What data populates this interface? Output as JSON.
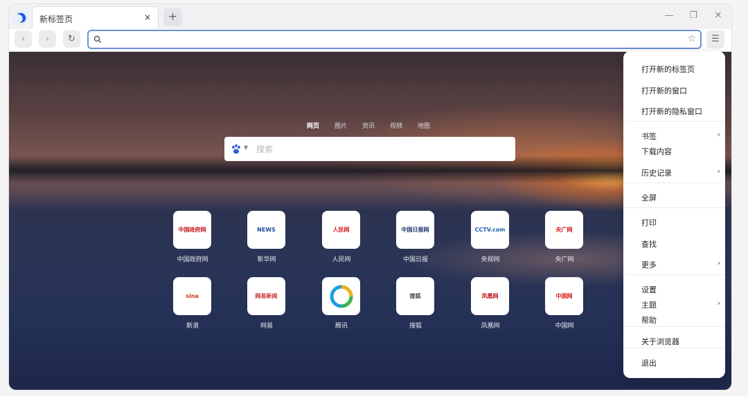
{
  "tab": {
    "title": "新标签页",
    "close_glyph": "×",
    "new_glyph": "+"
  },
  "window_controls": {
    "minimize": "—",
    "maximize": "❐",
    "close": "✕"
  },
  "toolbar": {
    "back_glyph": "‹",
    "forward_glyph": "›",
    "reload_glyph": "↻",
    "url_value": "",
    "url_placeholder": "",
    "bookmark_glyph": "☆",
    "menu_glyph": "☰"
  },
  "search": {
    "tabs": [
      "网页",
      "图片",
      "资讯",
      "视频",
      "地图"
    ],
    "active_tab": "网页",
    "placeholder": "搜索",
    "engine_icon": "baidu-paw-icon"
  },
  "tiles": [
    {
      "label": "中国政府网",
      "logo_text": "中国政府网",
      "logo_color": "#c8171e"
    },
    {
      "label": "新华网",
      "logo_text": "NEWS",
      "logo_color": "#1d4f9c"
    },
    {
      "label": "人民网",
      "logo_text": "人民网",
      "logo_color": "#d4161d"
    },
    {
      "label": "中国日报",
      "logo_text": "中国日报网",
      "logo_color": "#1f3a6e"
    },
    {
      "label": "央视网",
      "logo_text": "CCTV.com",
      "logo_color": "#1e5fb4"
    },
    {
      "label": "央广网",
      "logo_text": "央广网",
      "logo_color": "#d11c1c"
    },
    {
      "label": "新浪",
      "logo_text": "sina",
      "logo_color": "#d52b1e"
    },
    {
      "label": "网易",
      "logo_text": "网易新闻",
      "logo_color": "#c9302c"
    },
    {
      "label": "腾讯",
      "logo_text": "",
      "logo_color": "#1e9ee0"
    },
    {
      "label": "搜狐",
      "logo_text": "搜狐",
      "logo_color": "#444444"
    },
    {
      "label": "凤凰网",
      "logo_text": "凤凰网",
      "logo_color": "#c8161d"
    },
    {
      "label": "中国网",
      "logo_text": "中国网",
      "logo_color": "#d11c1c"
    }
  ],
  "menu": {
    "items": [
      {
        "label": "打开新的标签页",
        "arrow": ""
      },
      {
        "label": "打开新的窗口",
        "arrow": ""
      },
      {
        "label": "打开新的隐私窗口",
        "arrow": ""
      },
      {
        "label": "书签",
        "arrow": "›"
      },
      {
        "label": "下载内容",
        "arrow": ""
      },
      {
        "label": "历史记录",
        "arrow": "›"
      },
      {
        "label": "全屏",
        "arrow": ""
      },
      {
        "label": "打印",
        "arrow": ""
      },
      {
        "label": "查找",
        "arrow": ""
      },
      {
        "label": "更多",
        "arrow": "›"
      },
      {
        "label": "设置",
        "arrow": ""
      },
      {
        "label": "主题",
        "arrow": "›"
      },
      {
        "label": "帮助",
        "arrow": ""
      },
      {
        "label": "关于浏览器",
        "arrow": ""
      },
      {
        "label": "退出",
        "arrow": ""
      }
    ]
  }
}
